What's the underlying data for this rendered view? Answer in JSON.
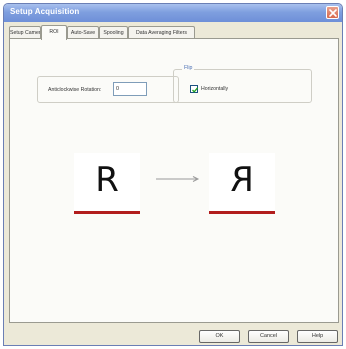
{
  "window": {
    "title": "Setup Acquisition"
  },
  "tabs": [
    {
      "label": "Setup Camera",
      "active": false
    },
    {
      "label": "ROI",
      "active": true
    },
    {
      "label": "Auto-Save",
      "active": false
    },
    {
      "label": "Spooling",
      "active": false
    },
    {
      "label": "Data Averaging Filters",
      "active": false
    }
  ],
  "rotation": {
    "label": "Anticlockwise Rotation:",
    "value": "0"
  },
  "flip": {
    "legend": "Flip",
    "horizontal_label": "Horizontally",
    "horizontal_checked": true
  },
  "preview": {
    "original_glyph": "R",
    "flipped_glyph": "R",
    "underline_color": "#b21d1d"
  },
  "buttons": {
    "ok": "OK",
    "cancel": "Cancel",
    "help": "Help"
  },
  "colors": {
    "titlebar": "#7f9fdf",
    "dialog_bg": "#ece9d8",
    "panel_bg": "#fbfbf8",
    "accent": "#4a6fb5"
  }
}
